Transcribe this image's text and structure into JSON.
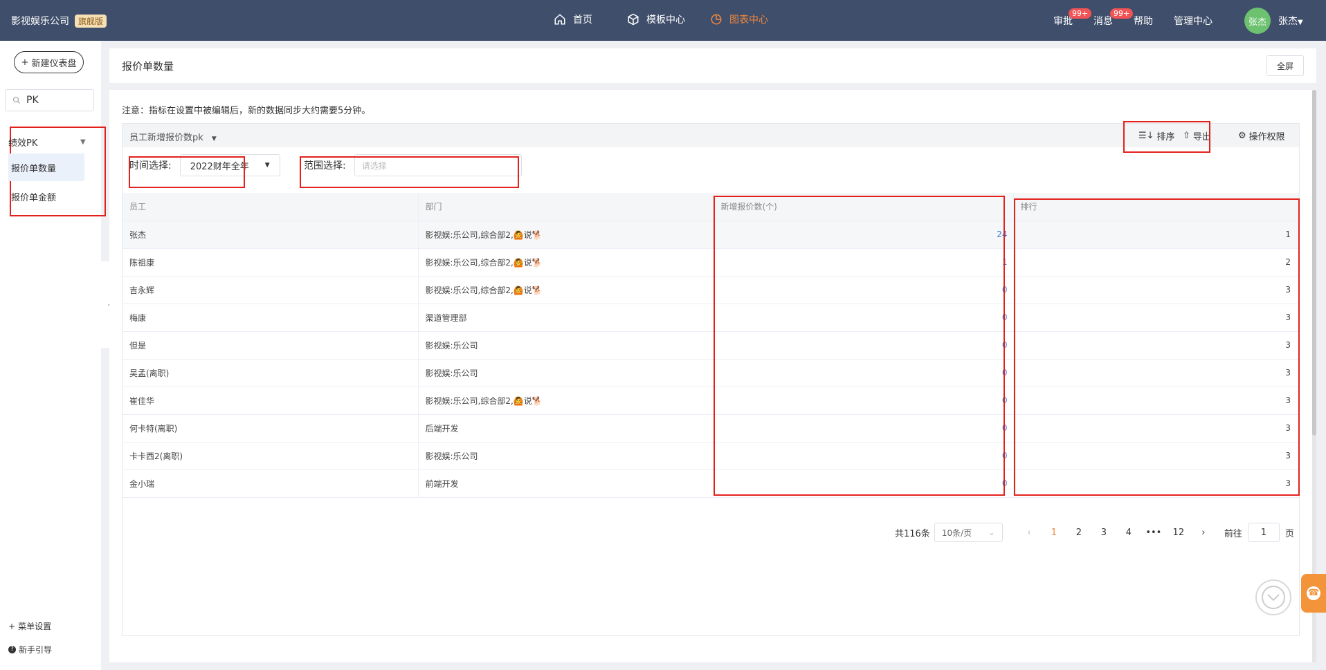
{
  "topbar": {
    "brand": "影视娱乐公司",
    "edition_badge": "旗舰版",
    "nav": [
      {
        "label": "首页",
        "icon": "home-icon"
      },
      {
        "label": "模板中心",
        "icon": "cube-icon"
      },
      {
        "label": "图表中心",
        "icon": "pie-chart-icon",
        "active": true
      }
    ],
    "approve_label": "审批",
    "approve_badge": "99+",
    "message_label": "消息",
    "message_badge": "99+",
    "help_label": "帮助",
    "admin_label": "管理中心",
    "avatar_text": "张杰",
    "user_name": "张杰",
    "colors": {
      "bar": "#3f4e6b",
      "active": "#f0883e",
      "badge": "#f25355"
    }
  },
  "sidebar": {
    "new_dashboard": "新建仪表盘",
    "search_value": "PK",
    "group_label": "绩效PK",
    "items": [
      {
        "label": "报价单数量",
        "active": true
      },
      {
        "label": "报价单金额",
        "active": false
      }
    ],
    "menu_settings": "菜单设置",
    "guide": "新手引导"
  },
  "header": {
    "title": "报价单数量",
    "fullscreen": "全屏"
  },
  "panel": {
    "note": "注意：指标在设置中被编辑后，新的数据同步大约需要5分钟。",
    "card_title": "员工新增报价数pk",
    "sort_label": "排序",
    "export_label": "导出",
    "permission_label": "操作权限",
    "time_label": "时间选择:",
    "time_value": "2022财年全年",
    "range_label": "范围选择:",
    "range_placeholder": "请选择"
  },
  "table": {
    "columns": [
      "员工",
      "部门",
      "新增报价数(个)",
      "排行"
    ],
    "rows": [
      {
        "name": "张杰",
        "dept": "影视娱:乐公司,综合部2,🙆说🐕",
        "count": "24",
        "rank": "1"
      },
      {
        "name": "陈祖康",
        "dept": "影视娱:乐公司,综合部2,🙆说🐕",
        "count": "1",
        "rank": "2"
      },
      {
        "name": "吉永辉",
        "dept": "影视娱:乐公司,综合部2,🙆说🐕",
        "count": "0",
        "rank": "3"
      },
      {
        "name": "梅康",
        "dept": "渠道管理部",
        "count": "0",
        "rank": "3"
      },
      {
        "name": "但是",
        "dept": "影视娱:乐公司",
        "count": "0",
        "rank": "3"
      },
      {
        "name": "吴孟(离职)",
        "dept": "影视娱:乐公司",
        "count": "0",
        "rank": "3"
      },
      {
        "name": "崔佳华",
        "dept": "影视娱:乐公司,综合部2,🙆说🐕",
        "count": "0",
        "rank": "3"
      },
      {
        "name": "何卡特(离职)",
        "dept": "后端开发",
        "count": "0",
        "rank": "3"
      },
      {
        "name": "卡卡西2(离职)",
        "dept": "影视娱:乐公司",
        "count": "0",
        "rank": "3"
      },
      {
        "name": "金小瑞",
        "dept": "前端开发",
        "count": "0",
        "rank": "3"
      }
    ]
  },
  "pager": {
    "total": "共116条",
    "page_size": "10条/页",
    "pages": [
      "1",
      "2",
      "3",
      "4",
      "•••",
      "12"
    ],
    "current": "1",
    "goto_label": "前往",
    "goto_value": "1",
    "page_suffix": "页"
  }
}
